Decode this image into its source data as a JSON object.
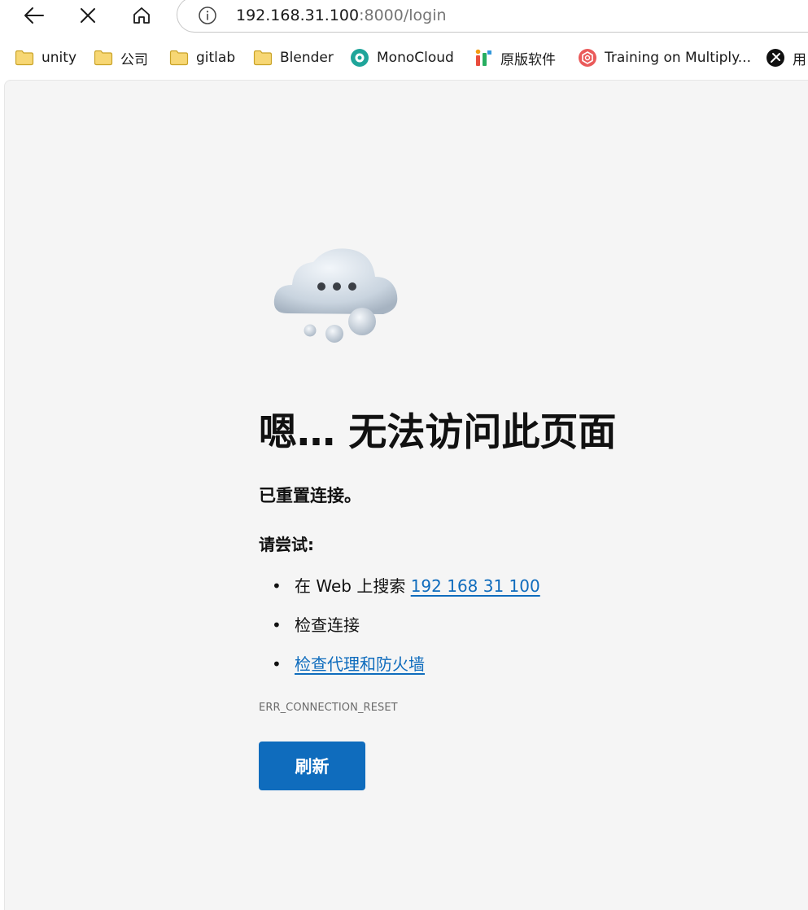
{
  "toolbar": {
    "url_host": "192.168.31.100",
    "url_path": ":8000/login"
  },
  "bookmarks": [
    {
      "label": "unity",
      "icon": "folder-icon"
    },
    {
      "label": "公司",
      "icon": "folder-icon"
    },
    {
      "label": "gitlab",
      "icon": "folder-icon"
    },
    {
      "label": "Blender",
      "icon": "folder-icon"
    },
    {
      "label": "MonoCloud",
      "icon": "monocloud-icon"
    },
    {
      "label": "原版软件",
      "icon": "itellyou-icon"
    },
    {
      "label": "Training on Multiply...",
      "icon": "openai-icon"
    },
    {
      "label": "用",
      "icon": "site-icon"
    }
  ],
  "error": {
    "heading": "嗯… 无法访问此页面",
    "subheading": "已重置连接。",
    "try_label": "请尝试:",
    "suggestions": [
      {
        "prefix": "在 Web 上搜索 ",
        "link": "192 168 31 100"
      },
      {
        "text": "检查连接"
      },
      {
        "link": "检查代理和防火墙"
      }
    ],
    "code": "ERR_CONNECTION_RESET",
    "refresh_label": "刷新"
  },
  "colors": {
    "link": "#0f6cbd",
    "button": "#0f6cbd",
    "page_background": "#f5f5f5",
    "folder": "#f7d774"
  }
}
